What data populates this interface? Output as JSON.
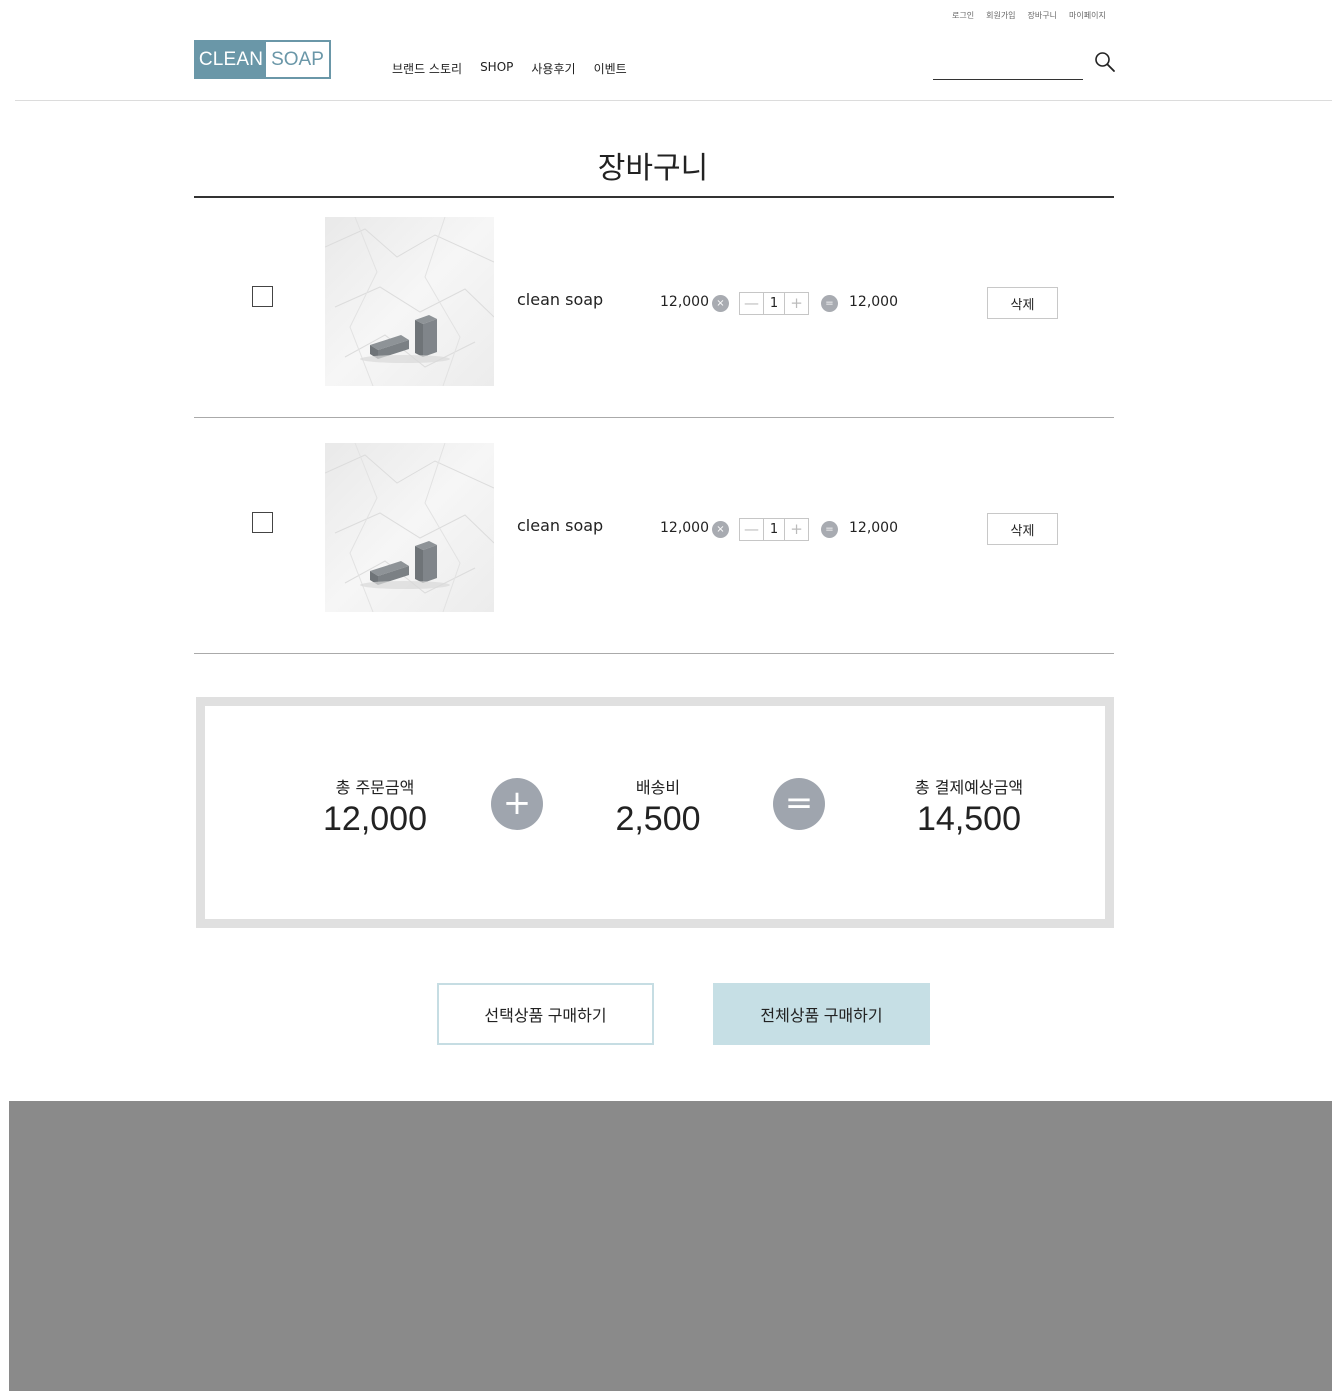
{
  "util_nav": [
    "로그인",
    "회원가입",
    "장바구니",
    "마이페이지"
  ],
  "logo": {
    "left": "CLEAN",
    "right": "SOAP",
    "color": "#6a97a8"
  },
  "main_nav": [
    "브랜드 스토리",
    "SHOP",
    "사용후기",
    "이벤트"
  ],
  "search": {
    "placeholder": "",
    "icon": "search-icon"
  },
  "page_title": "장바구니",
  "cart_items": [
    {
      "name": "clean soap",
      "price": "12,000",
      "quantity": "1",
      "total": "12,000",
      "delete_label": "삭제",
      "checked": false
    },
    {
      "name": "clean soap",
      "price": "12,000",
      "quantity": "1",
      "total": "12,000",
      "delete_label": "삭제",
      "checked": false
    }
  ],
  "summary": {
    "order_label": "총 주문금액",
    "order_value": "12,000",
    "shipping_label": "배송비",
    "shipping_value": "2,500",
    "total_label": "총 결제예상금액",
    "total_value": "14,500"
  },
  "buttons": {
    "select_purchase": "선택상품 구매하기",
    "all_purchase": "전체상품 구매하기"
  },
  "colors": {
    "accent": "#6a97a8",
    "buy_all_bg": "#c6dfe5",
    "footer": "#8a8a8a",
    "operator_circle": "#9fa5ae"
  }
}
